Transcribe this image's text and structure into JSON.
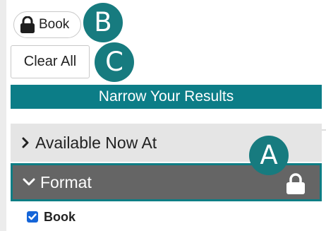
{
  "applied_filter": {
    "label": "Book",
    "icon": "lock-icon"
  },
  "callouts": {
    "a": "A",
    "b": "B",
    "c": "C"
  },
  "clear_all_label": "Clear All",
  "narrow_header": "Narrow Your Results",
  "facets": {
    "available": {
      "label": "Available Now At",
      "expanded": false
    },
    "format": {
      "label": "Format",
      "expanded": true,
      "locked": true,
      "options": [
        {
          "label": "Book",
          "checked": true
        }
      ]
    }
  },
  "colors": {
    "teal": "#0c7d87",
    "facet_selected_bg": "#656565",
    "facet_bg": "#e5e5e5",
    "checkbox": "#1565d8"
  }
}
